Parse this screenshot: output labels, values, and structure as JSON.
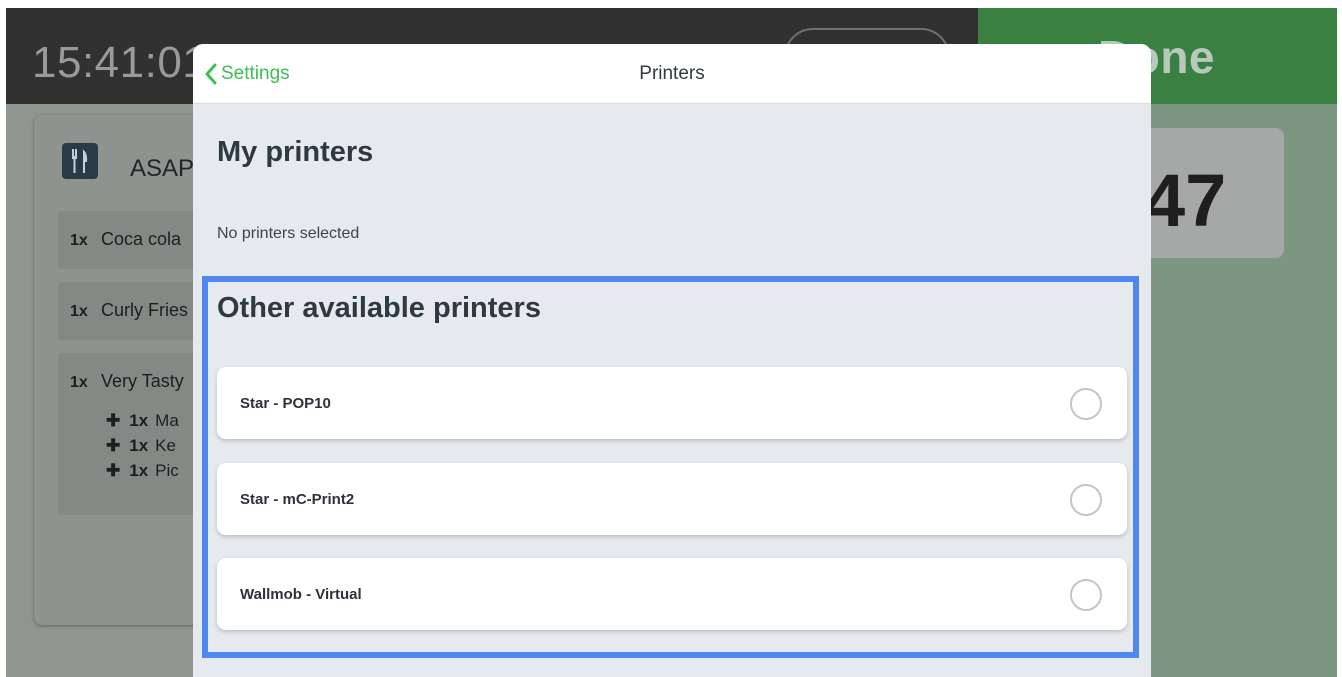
{
  "background": {
    "clock": "15:41:01",
    "done_label": "Done",
    "order_number": "47",
    "order_type": "ASAP",
    "order_lines": [
      {
        "qty": "1x",
        "name": "Coca cola"
      },
      {
        "qty": "1x",
        "name": "Curly Fries"
      },
      {
        "qty": "1x",
        "name": "Very Tasty"
      }
    ],
    "modifiers": [
      {
        "qty": "1x",
        "name": "Ma"
      },
      {
        "qty": "1x",
        "name": "Ke"
      },
      {
        "qty": "1x",
        "name": "Pic"
      }
    ]
  },
  "modal": {
    "back_label": "Settings",
    "title": "Printers",
    "my_printers": {
      "heading": "My printers",
      "empty_text": "No printers selected"
    },
    "other_printers": {
      "heading": "Other available printers",
      "items": [
        {
          "name": "Star - POP10",
          "selected": false
        },
        {
          "name": "Star - mC-Print2",
          "selected": false
        },
        {
          "name": "Wallmob - Virtual",
          "selected": false
        }
      ]
    }
  },
  "colors": {
    "accent_green": "#3fbf52",
    "highlight_blue": "#4f86f0",
    "done_green": "#3a8040"
  }
}
